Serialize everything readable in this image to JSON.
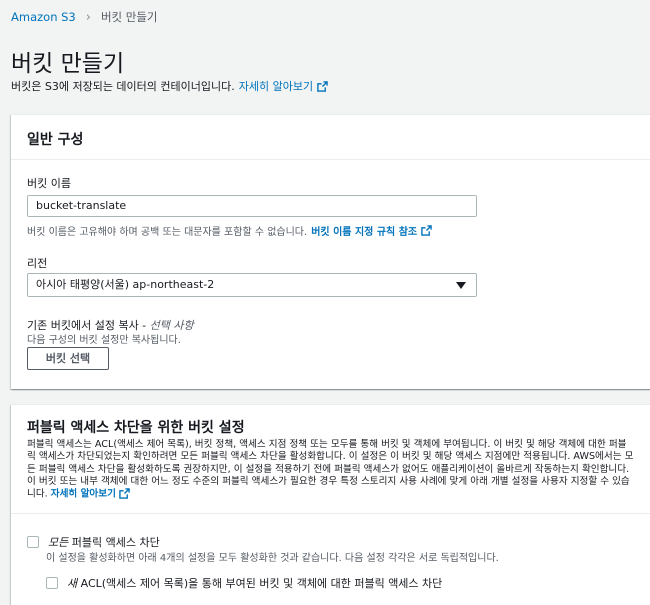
{
  "breadcrumb": {
    "root": "Amazon S3",
    "current": "버킷 만들기"
  },
  "page": {
    "title": "버킷 만들기",
    "description": "버킷은 S3에 저장되는 데이터의 컨테이너입니다.",
    "learn_more": "자세히 알아보기"
  },
  "general": {
    "title": "일반 구성",
    "bucket_name_label": "버킷 이름",
    "bucket_name_value": "bucket-translate",
    "bucket_name_hint": "버킷 이름은 고유해야 하며 공백 또는 대문자를 포함할 수 없습니다.",
    "bucket_name_rules_link": "버킷 이름 지정 규칙 참조",
    "region_label": "리전",
    "region_value": "아시아 태평양(서울) ap-northeast-2",
    "copy_label": "기존 버킷에서 설정 복사 -",
    "copy_optional": "선택 사항",
    "copy_desc": "다음 구성의 버킷 설정만 복사됩니다.",
    "choose_bucket_button": "버킷 선택"
  },
  "public_access": {
    "title": "퍼블릭 액세스 차단을 위한 버킷 설정",
    "description": "퍼블릭 액세스는 ACL(액세스 제어 목록), 버킷 정책, 액세스 지점 정책 또는 모두를 통해 버킷 및 객체에 부여됩니다. 이 버킷 및 해당 객체에 대한 퍼블릭 액세스가 차단되었는지 확인하려면 모든 퍼블릭 액세스 차단을 활성화합니다. 이 설정은 이 버킷 및 해당 액세스 지점에만 적용됩니다. AWS에서는 모든 퍼블릭 액세스 차단을 활성화하도록 권장하지만, 이 설정을 적용하기 전에 퍼블릭 액세스가 없어도 애플리케이션이 올바르게 작동하는지 확인합니다. 이 버킷 또는 내부 객체에 대한 어느 정도 수준의 퍼블릭 액세스가 필요한 경우 특정 스토리지 사용 사례에 맞게 아래 개별 설정을 사용자 지정할 수 있습니다.",
    "learn_more": "자세히 알아보기",
    "block_all_em": "모든",
    "block_all_rest": " 퍼블릭 액세스 차단",
    "block_all_desc": "이 설정을 활성화하면 아래 4개의 설정을 모두 활성화한 것과 같습니다. 다음 설정 각각은 서로 독립적입니다.",
    "acl_em": "새",
    "acl_rest": " ACL(액세스 제어 목록)을 통해 부여된 버킷 및 객체에 대한 퍼블릭 액세스 차단"
  },
  "colors": {
    "link": "#0073bb",
    "background": "#f2f3f3",
    "panel": "#ffffff"
  }
}
